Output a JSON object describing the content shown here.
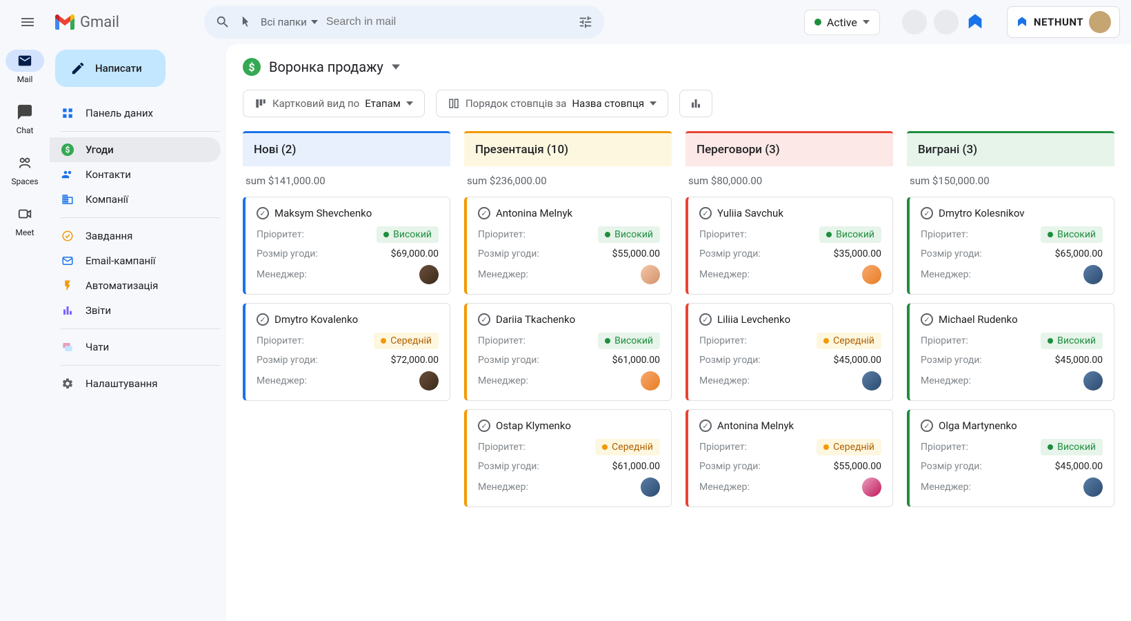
{
  "topbar": {
    "logo_text": "Gmail",
    "folder_label": "Всі папки",
    "search_placeholder": "Search in mail",
    "active_label": "Active",
    "nethunt_label": "NETHUNT"
  },
  "rail": {
    "mail": "Mail",
    "chat": "Chat",
    "spaces": "Spaces",
    "meet": "Meet"
  },
  "sidebar": {
    "compose": "Написати",
    "dashboard": "Панель даних",
    "deals": "Угоди",
    "contacts": "Контакти",
    "companies": "Компанії",
    "tasks": "Завдання",
    "email_campaigns": "Email-кампанії",
    "automation": "Автоматизація",
    "reports": "Звіти",
    "chats": "Чати",
    "settings": "Налаштування"
  },
  "main": {
    "title": "Воронка продажу",
    "view_prefix": "Картковий вид по",
    "view_value": "Етапам",
    "sort_prefix": "Порядок стовпців за",
    "sort_value": "Назва стовпця"
  },
  "labels": {
    "priority": "Пріоритет:",
    "deal_size": "Розмір угоди:",
    "manager": "Менеджер:",
    "high": "Високий",
    "medium": "Середній"
  },
  "columns": [
    {
      "title": "Нові (2)",
      "sum": "sum $141,000.00",
      "color": "blue",
      "cards": [
        {
          "name": "Maksym Shevchenko",
          "priority": "high",
          "amount": "$69,000.00",
          "avatar": "av-1"
        },
        {
          "name": "Dmytro Kovalenko",
          "priority": "med",
          "amount": "$72,000.00",
          "avatar": "av-1"
        }
      ]
    },
    {
      "title": "Презентація (10)",
      "sum": "sum $236,000.00",
      "color": "orange",
      "cards": [
        {
          "name": "Antonina Melnyk",
          "priority": "high",
          "amount": "$55,000.00",
          "avatar": "av-2"
        },
        {
          "name": "Dariia Tkachenko",
          "priority": "high",
          "amount": "$61,000.00",
          "avatar": "av-3"
        },
        {
          "name": "Ostap Klymenko",
          "priority": "med",
          "amount": "$61,000.00",
          "avatar": "av-4"
        }
      ]
    },
    {
      "title": "Переговори (3)",
      "sum": "sum $80,000.00",
      "color": "red",
      "cards": [
        {
          "name": "Yuliia Savchuk",
          "priority": "high",
          "amount": "$35,000.00",
          "avatar": "av-3"
        },
        {
          "name": "Liliia Levchenko",
          "priority": "med",
          "amount": "$45,000.00",
          "avatar": "av-4"
        },
        {
          "name": "Antonina Melnyk",
          "priority": "med",
          "amount": "$55,000.00",
          "avatar": "av-5"
        }
      ]
    },
    {
      "title": "Виграні (3)",
      "sum": "sum $150,000.00",
      "color": "green",
      "cards": [
        {
          "name": "Dmytro Kolesnikov",
          "priority": "high",
          "amount": "$65,000.00",
          "avatar": "av-4"
        },
        {
          "name": "Michael Rudenko",
          "priority": "high",
          "amount": "$45,000.00",
          "avatar": "av-4"
        },
        {
          "name": "Olga Martynenko",
          "priority": "high",
          "amount": "$45,000.00",
          "avatar": "av-4"
        }
      ]
    }
  ]
}
